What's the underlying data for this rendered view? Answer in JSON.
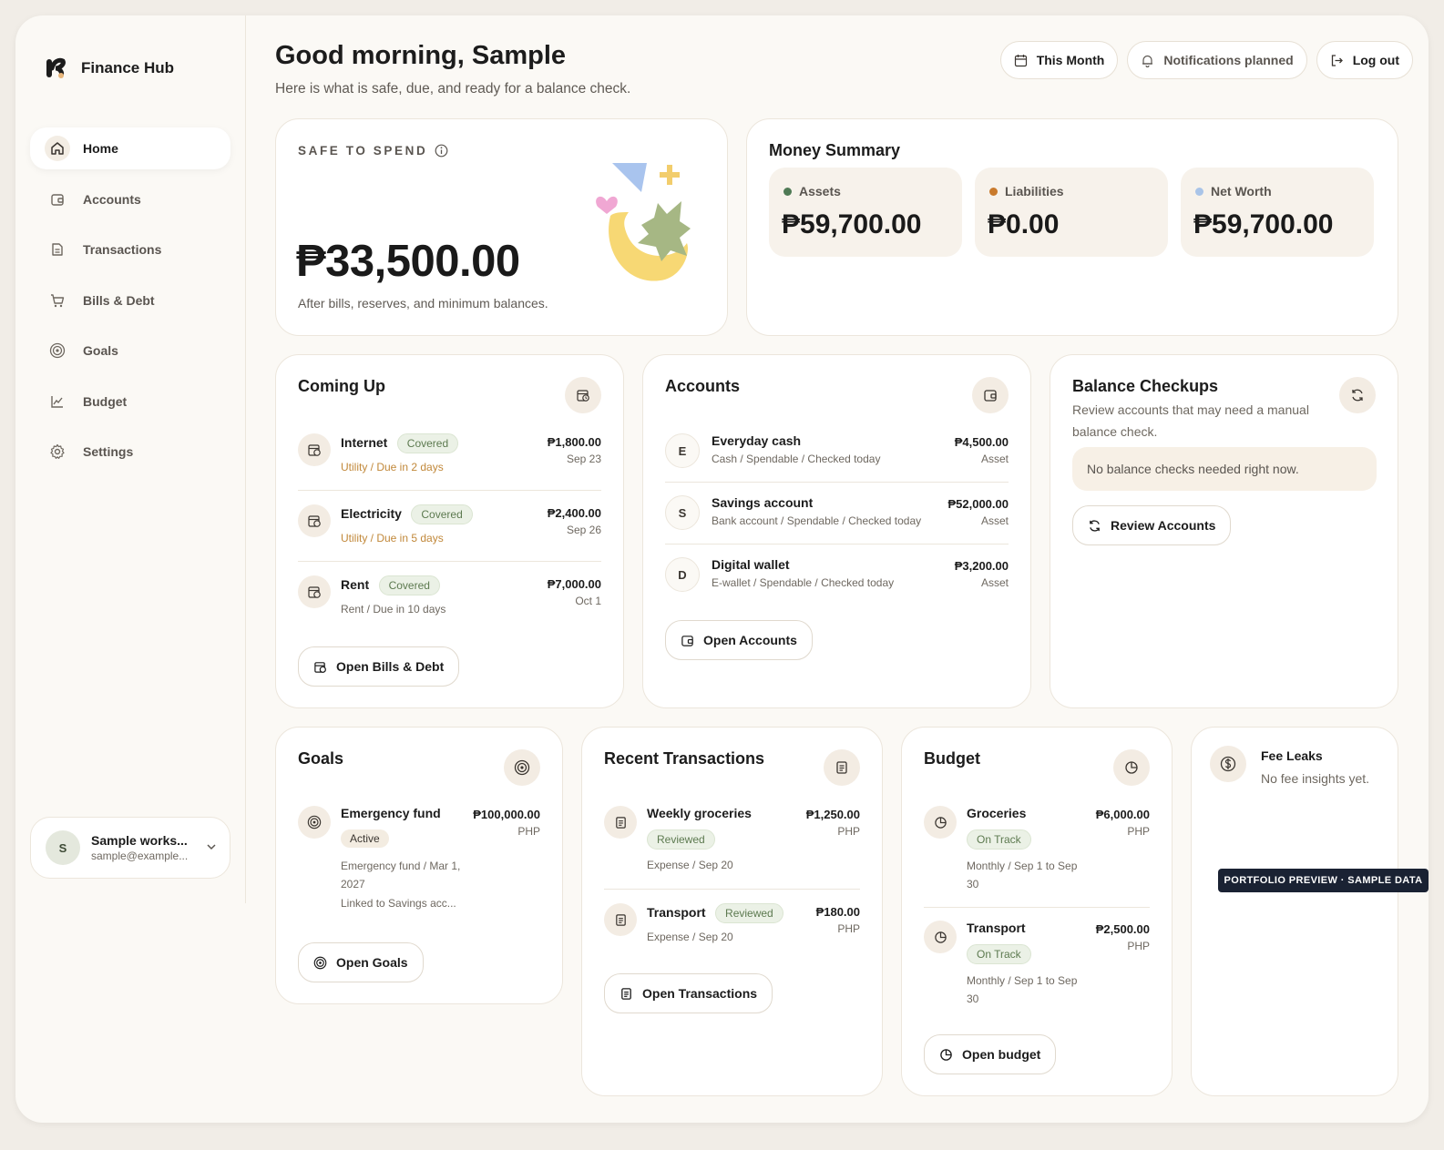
{
  "app": {
    "name": "Finance Hub"
  },
  "sidebar": {
    "items": [
      {
        "label": "Home",
        "icon": "home-icon",
        "active": true
      },
      {
        "label": "Accounts",
        "icon": "wallet-icon"
      },
      {
        "label": "Transactions",
        "icon": "document-icon"
      },
      {
        "label": "Bills & Debt",
        "icon": "cart-icon"
      },
      {
        "label": "Goals",
        "icon": "target-icon"
      },
      {
        "label": "Budget",
        "icon": "chart-icon"
      },
      {
        "label": "Settings",
        "icon": "gear-icon"
      }
    ],
    "user": {
      "name": "Sample works...",
      "email": "sample@example...",
      "initial": "S"
    }
  },
  "header": {
    "greeting": "Good morning, Sample",
    "subtitle": "Here is what is safe, due, and ready for a balance check.",
    "actions": {
      "period": "This Month",
      "notifications": "Notifications planned",
      "logout": "Log out"
    }
  },
  "safe_to_spend": {
    "label": "SAFE TO SPEND",
    "amount": "₱33,500.00",
    "note": "After bills, reserves, and minimum balances."
  },
  "money_summary": {
    "title": "Money Summary",
    "assets": {
      "label": "Assets",
      "value": "₱59,700.00",
      "color": "#4f7a55"
    },
    "liabilities": {
      "label": "Liabilities",
      "value": "₱0.00",
      "color": "#c97a2c"
    },
    "net_worth": {
      "label": "Net Worth",
      "value": "₱59,700.00",
      "color": "#a9c4e8"
    }
  },
  "coming_up": {
    "title": "Coming Up",
    "items": [
      {
        "name": "Internet",
        "badge": "Covered",
        "sub": "Utility / Due in 2 days",
        "amount": "₱1,800.00",
        "date": "Sep 23"
      },
      {
        "name": "Electricity",
        "badge": "Covered",
        "sub": "Utility / Due in 5 days",
        "amount": "₱2,400.00",
        "date": "Sep 26"
      },
      {
        "name": "Rent",
        "badge": "Covered",
        "sub": "Rent / Due in 10 days",
        "amount": "₱7,000.00",
        "date": "Oct 1"
      }
    ],
    "button": "Open Bills & Debt"
  },
  "accounts": {
    "title": "Accounts",
    "items": [
      {
        "initial": "E",
        "name": "Everyday cash",
        "sub": "Cash / Spendable / Checked today",
        "amount": "₱4,500.00",
        "type": "Asset"
      },
      {
        "initial": "S",
        "name": "Savings account",
        "sub": "Bank account / Spendable / Checked today",
        "amount": "₱52,000.00",
        "type": "Asset"
      },
      {
        "initial": "D",
        "name": "Digital wallet",
        "sub": "E-wallet / Spendable / Checked today",
        "amount": "₱3,200.00",
        "type": "Asset"
      }
    ],
    "button": "Open Accounts"
  },
  "balance_checkups": {
    "title": "Balance Checkups",
    "description": "Review accounts that may need a manual balance check.",
    "empty": "No balance checks needed right now.",
    "button": "Review Accounts"
  },
  "goals": {
    "title": "Goals",
    "item": {
      "name": "Emergency fund",
      "badge": "Active",
      "sub1": "Emergency fund / Mar 1, 2027",
      "sub2": "Linked to Savings acc...",
      "amount": "₱100,000.00",
      "currency": "PHP"
    },
    "button": "Open Goals"
  },
  "recent_transactions": {
    "title": "Recent Transactions",
    "items": [
      {
        "name": "Weekly groceries",
        "badge": "Reviewed",
        "sub": "Expense / Sep 20",
        "amount": "₱1,250.00",
        "currency": "PHP"
      },
      {
        "name": "Transport",
        "badge": "Reviewed",
        "sub": "Expense / Sep 20",
        "amount": "₱180.00",
        "currency": "PHP"
      }
    ],
    "button": "Open Transactions"
  },
  "budget": {
    "title": "Budget",
    "items": [
      {
        "name": "Groceries",
        "badge": "On Track",
        "sub": "Monthly / Sep 1 to Sep 30",
        "amount": "₱6,000.00",
        "currency": "PHP"
      },
      {
        "name": "Transport",
        "badge": "On Track",
        "sub": "Monthly / Sep 1 to Sep 30",
        "amount": "₱2,500.00",
        "currency": "PHP"
      }
    ],
    "button": "Open budget"
  },
  "fee_leaks": {
    "title": "Fee Leaks",
    "text": "No fee insights yet."
  },
  "preview_tag": "PORTFOLIO PREVIEW · SAMPLE DATA"
}
